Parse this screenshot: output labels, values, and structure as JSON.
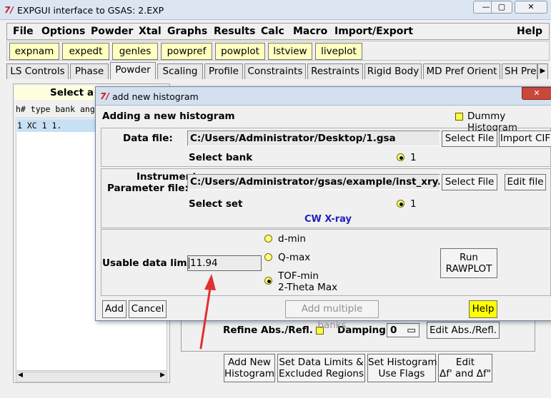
{
  "window": {
    "title": "EXPGUI interface to GSAS: 2.EXP"
  },
  "menubar": [
    "File",
    "Options",
    "Powder",
    "Xtal",
    "Graphs",
    "Results",
    "Calc",
    "Macro",
    "Import/Export",
    "Help"
  ],
  "toolbar": [
    "expnam",
    "expedt",
    "genles",
    "powpref",
    "powplot",
    "lstview",
    "liveplot"
  ],
  "tabs": [
    "LS Controls",
    "Phase",
    "Powder",
    "Scaling",
    "Profile",
    "Constraints",
    "Restraints",
    "Rigid Body",
    "MD Pref Orient",
    "SH Pre"
  ],
  "active_tab": "Powder",
  "left_panel": {
    "header": "Select a",
    "columns": "h# type bank ang",
    "row": "1  XC     1  1."
  },
  "behind": {
    "refine_label": "Refine Abs./Refl.",
    "damping_label": "Damping",
    "damping_value": "0",
    "edit_abs": "Edit Abs./Refl.",
    "add_new": "Add New\nHistogram",
    "set_limits": "Set Data Limits &\nExcluded Regions",
    "set_flags": "Set Histogram\nUse Flags",
    "edit_f": "Edit\nΔf' and Δf\""
  },
  "dialog": {
    "title": "add new histogram",
    "heading": "Adding a new histogram",
    "dummy_label": "Dummy Histogram",
    "data_file_label": "Data file:",
    "data_file_value": "C:/Users/Administrator/Desktop/1.gsa",
    "select_file": "Select File",
    "import_cif": "Import CIF",
    "select_bank": "Select bank",
    "bank_option": "1",
    "inst_label_1": "Instrument",
    "inst_label_2": "Parameter file:",
    "inst_file_value": "C:/Users/Administrator/gsas/example/inst_xry.prm",
    "select_file_2": "Select File",
    "edit_file": "Edit file",
    "select_set": "Select set",
    "set_option": "1",
    "radiation": "CW X-ray",
    "usable_label": "Usable data limit:",
    "usable_value": "11.94",
    "limit_options": [
      "d-min",
      "Q-max",
      "TOF-min"
    ],
    "limit_option_sub": "2-Theta Max",
    "run_rawplot": "Run\nRAWPLOT",
    "add": "Add",
    "cancel": "Cancel",
    "add_multiple": "Add multiple banks",
    "help": "Help"
  },
  "colors": {
    "accent_yellow": "#ffff40",
    "radiation_blue": "#2020c0",
    "arrow_red": "#e03030"
  }
}
